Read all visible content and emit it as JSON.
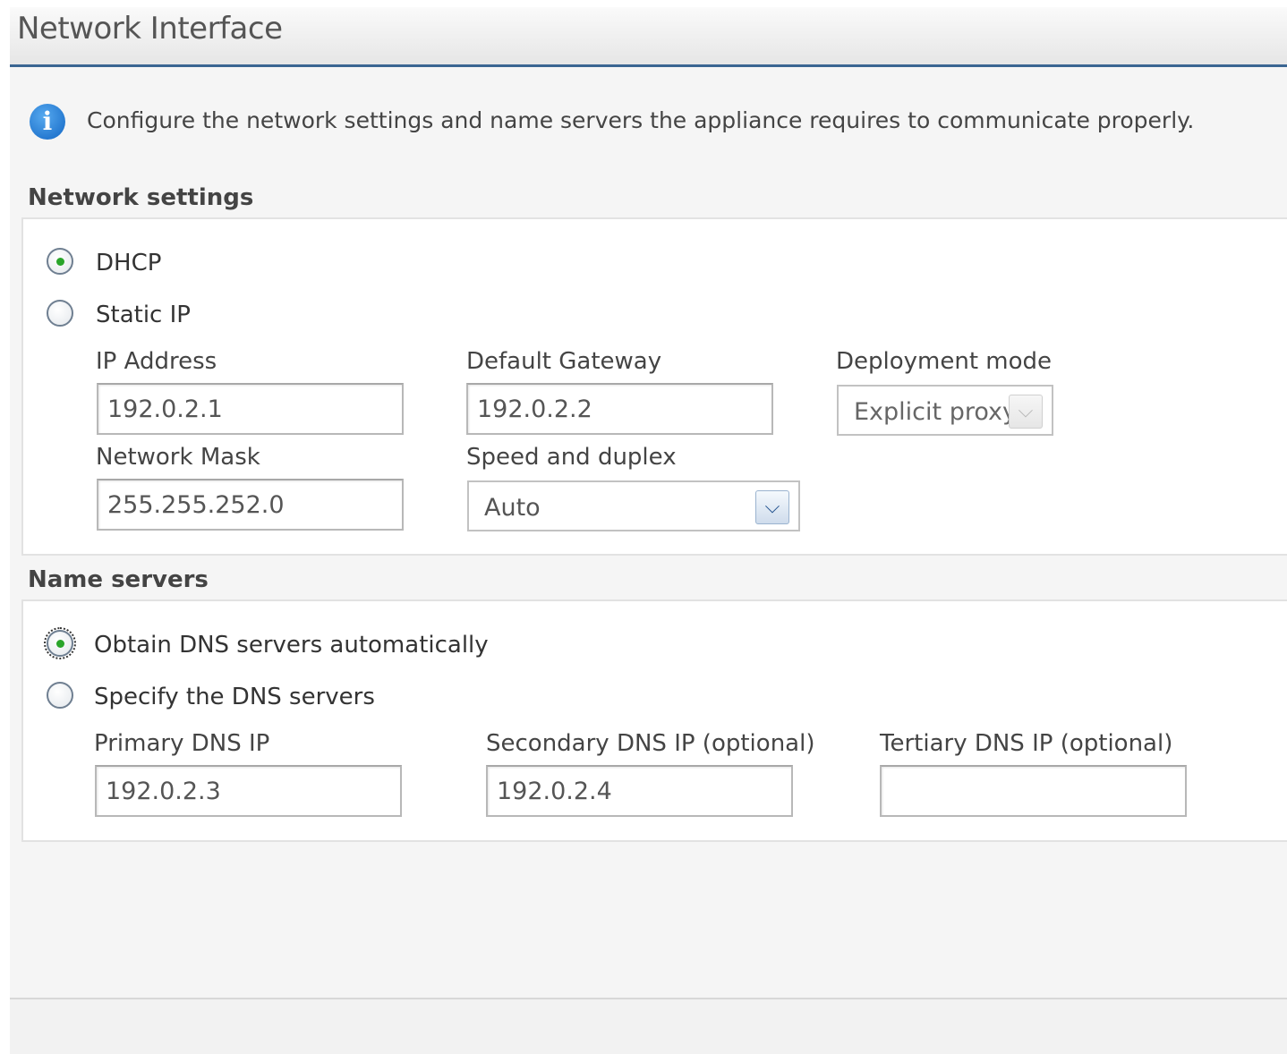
{
  "title": "Network Interface",
  "info": {
    "icon": "info-icon",
    "text": "Configure the network settings and name servers the appliance requires to communicate properly."
  },
  "network_settings": {
    "heading": "Network settings",
    "mode_options": [
      {
        "label": "DHCP",
        "checked": true
      },
      {
        "label": "Static IP",
        "checked": false
      }
    ],
    "ip_address": {
      "label": "IP Address",
      "value": "192.0.2.1"
    },
    "network_mask": {
      "label": "Network Mask",
      "value": "255.255.252.0"
    },
    "default_gateway": {
      "label": "Default Gateway",
      "value": "192.0.2.2"
    },
    "speed_duplex": {
      "label": "Speed and duplex",
      "value": "Auto"
    },
    "deployment_mode": {
      "label": "Deployment mode",
      "value": "Explicit proxy",
      "disabled": true
    }
  },
  "name_servers": {
    "heading": "Name servers",
    "options": [
      {
        "label": "Obtain DNS servers automatically",
        "checked": true
      },
      {
        "label": "Specify the DNS servers",
        "checked": false
      }
    ],
    "primary": {
      "label": "Primary DNS IP",
      "value": "192.0.2.3"
    },
    "secondary": {
      "label": "Secondary DNS IP (optional)",
      "value": "192.0.2.4"
    },
    "tertiary": {
      "label": "Tertiary DNS IP (optional)",
      "value": ""
    }
  },
  "colors": {
    "accent": "#3a6591",
    "info_icon": "#1a73d1",
    "radio_selected": "#2aa52a"
  }
}
